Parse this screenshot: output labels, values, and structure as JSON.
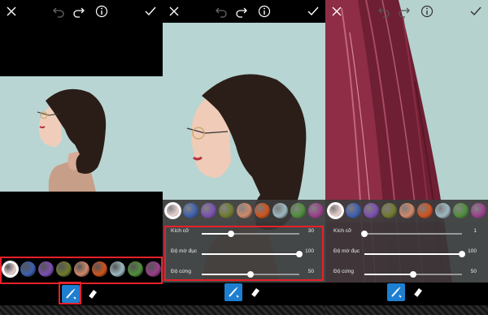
{
  "icons": {
    "close": "close-icon",
    "undo": "undo-icon",
    "redo": "redo-icon",
    "info": "info-icon",
    "check": "check-icon",
    "brush": "brush-icon",
    "eraser": "eraser-icon"
  },
  "colors": {
    "highlight": "#e8202a",
    "brush_active": "#1e7fd1"
  },
  "swatches": [
    {
      "name": "white",
      "color": "#e9d2d0"
    },
    {
      "name": "blue",
      "color": "#3c5fae"
    },
    {
      "name": "purple",
      "color": "#7b4fb0"
    },
    {
      "name": "olive",
      "color": "#6f7a2d"
    },
    {
      "name": "peach",
      "color": "#d08869"
    },
    {
      "name": "orange",
      "color": "#d0531d"
    },
    {
      "name": "silver",
      "color": "#9cb8c0"
    },
    {
      "name": "green",
      "color": "#4f8e3a"
    },
    {
      "name": "magenta",
      "color": "#9b3e8c"
    }
  ],
  "sliders": [
    {
      "label": "Kích cỡ",
      "value": "30",
      "level": 0.3
    },
    {
      "label": "Độ mờ đục",
      "value": "100",
      "level": 1.0
    },
    {
      "label": "Độ cứng",
      "value": "50",
      "level": 0.5
    }
  ],
  "sliders_panel3": [
    {
      "label": "Kích cỡ",
      "value": "1",
      "level": 0.0
    },
    {
      "label": "Độ mờ đục",
      "value": "100",
      "level": 1.0
    },
    {
      "label": "Độ cứng",
      "value": "50",
      "level": 0.5
    }
  ]
}
